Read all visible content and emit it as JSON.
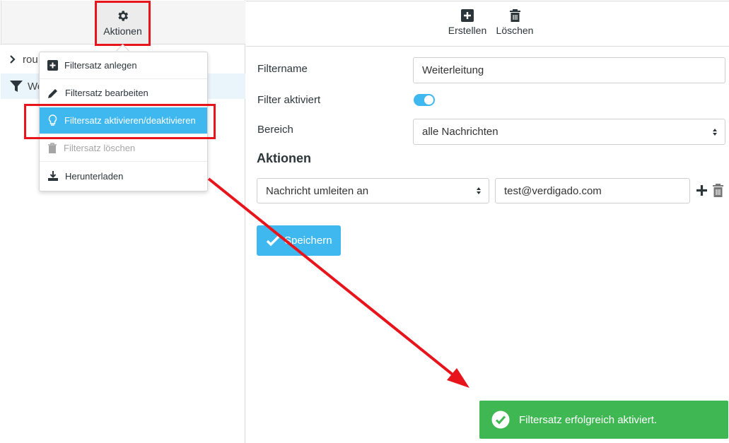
{
  "left_toolbar": {
    "actions_label": "Aktionen"
  },
  "right_toolbar": {
    "create_label": "Erstellen",
    "delete_label": "Löschen"
  },
  "tree": {
    "root_label": "rou",
    "filter_label": "We"
  },
  "menu": {
    "items": [
      {
        "label": "Filtersatz anlegen",
        "icon": "plus-square-icon"
      },
      {
        "label": "Filtersatz bearbeiten",
        "icon": "pencil-icon"
      },
      {
        "label": "Filtersatz aktivieren/deaktivieren",
        "icon": "lightbulb-icon"
      },
      {
        "label": "Filtersatz löschen",
        "icon": "trash-icon"
      },
      {
        "label": "Herunterladen",
        "icon": "download-icon"
      }
    ]
  },
  "form": {
    "filtername_label": "Filtername",
    "filtername_value": "Weiterleitung",
    "enabled_label": "Filter aktiviert",
    "enabled": true,
    "scope_label": "Bereich",
    "scope_value": "alle Nachrichten",
    "actions_heading": "Aktionen",
    "action_value": "Nachricht umleiten an",
    "action_target": "test@verdigado.com",
    "save_label": "Speichern"
  },
  "toast": {
    "message": "Filtersatz erfolgreich aktiviert."
  },
  "colors": {
    "accent": "#3fb8f0",
    "success": "#3fb853",
    "annotation": "#e8141c"
  }
}
